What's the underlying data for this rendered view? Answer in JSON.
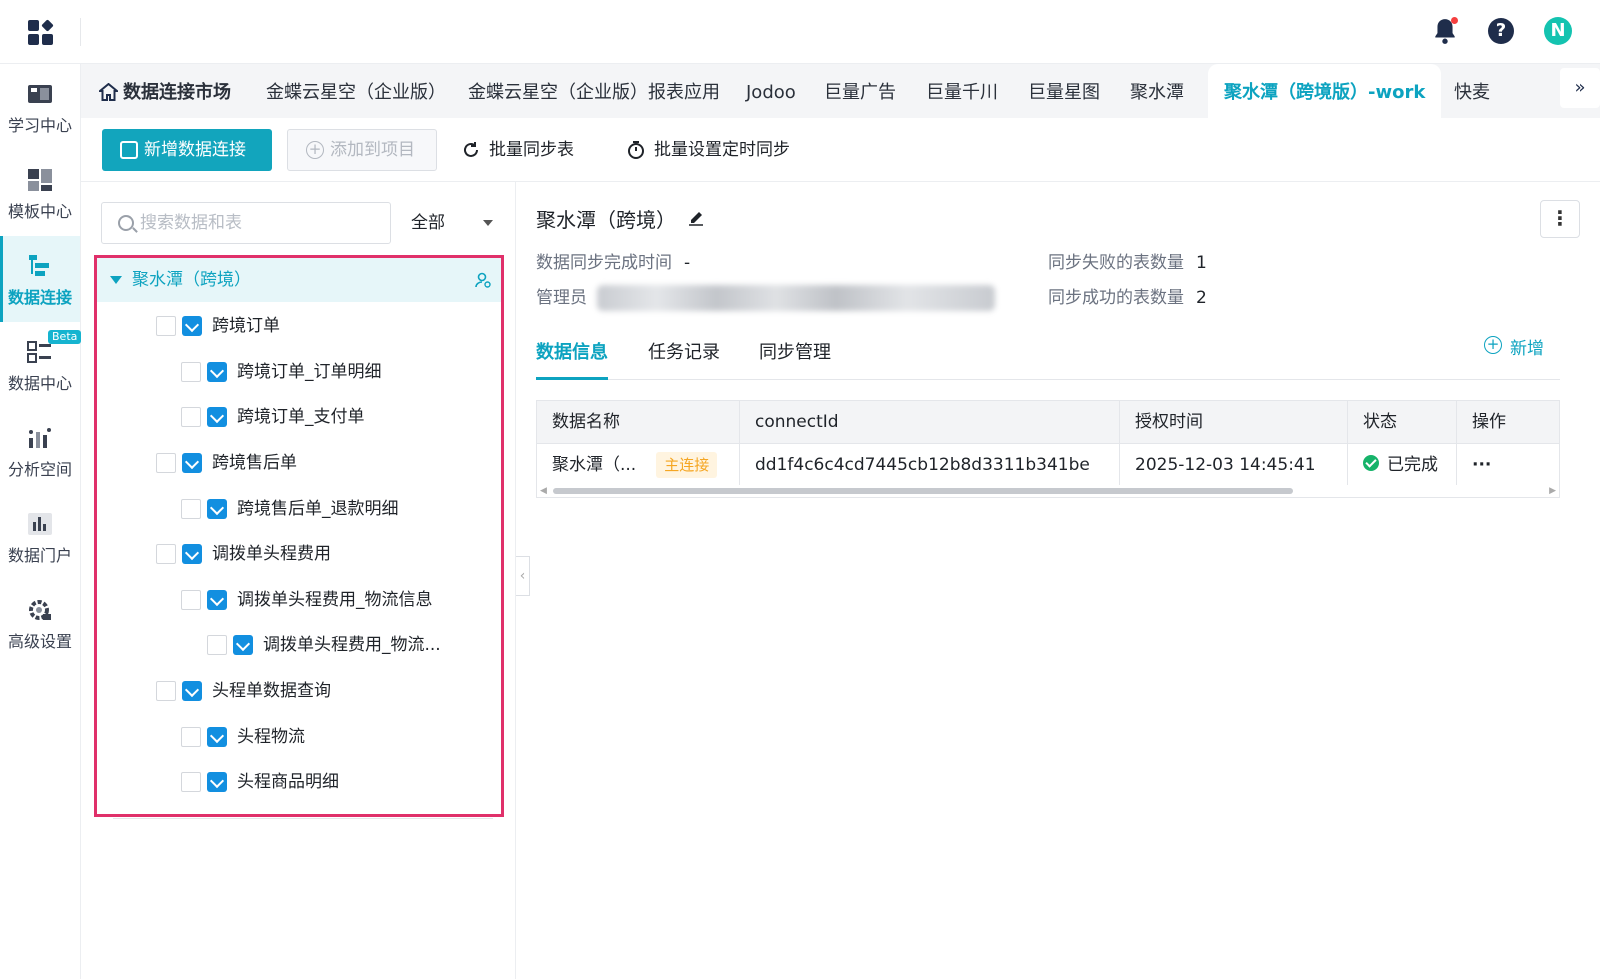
{
  "nav": {
    "items": [
      {
        "label": "学习中心",
        "icon": "learning-center-icon"
      },
      {
        "label": "模板中心",
        "icon": "template-center-icon"
      },
      {
        "label": "数据连接",
        "icon": "data-connection-icon",
        "active": true
      },
      {
        "label": "数据中心",
        "icon": "data-center-icon",
        "badge": "Beta"
      },
      {
        "label": "分析空间",
        "icon": "analysis-space-icon"
      },
      {
        "label": "数据门户",
        "icon": "data-portal-icon"
      },
      {
        "label": "高级设置",
        "icon": "advanced-settings-icon"
      }
    ]
  },
  "topbar": {
    "avatar_letter": "N",
    "help_glyph": "?"
  },
  "tabs": {
    "home": "数据连接市场",
    "items": [
      "金蝶云星空（企业版）",
      "金蝶云星空（企业版）报表应用",
      "Jodoo",
      "巨量广告",
      "巨量千川",
      "巨量星图",
      "聚水潭",
      "聚水潭（跨境版）-work",
      "快麦"
    ],
    "active_index": 7,
    "more_glyph": "»"
  },
  "toolbar": {
    "new_connection": "新增数据连接",
    "add_to_project": "添加到项目",
    "batch_sync": "批量同步表",
    "batch_schedule": "批量设置定时同步"
  },
  "tree": {
    "search_placeholder": "搜索数据和表",
    "filter": "全部",
    "root": "聚水潭（跨境）",
    "nodes": [
      {
        "label": "跨境订单",
        "level": 0
      },
      {
        "label": "跨境订单_订单明细",
        "level": 1
      },
      {
        "label": "跨境订单_支付单",
        "level": 1
      },
      {
        "label": "跨境售后单",
        "level": 0
      },
      {
        "label": "跨境售后单_退款明细",
        "level": 1
      },
      {
        "label": "调拨单头程费用",
        "level": 0
      },
      {
        "label": "调拨单头程费用_物流信息",
        "level": 1
      },
      {
        "label": "调拨单头程费用_物流...",
        "level": 2
      },
      {
        "label": "头程单数据查询",
        "level": 0
      },
      {
        "label": "头程物流",
        "level": 1
      },
      {
        "label": "头程商品明细",
        "level": 1
      }
    ]
  },
  "detail": {
    "title": "聚水潭（跨境）",
    "sync_time_label": "数据同步完成时间",
    "sync_time_value": "-",
    "admin_label": "管理员",
    "failed_label": "同步失败的表数量",
    "failed_value": "1",
    "success_label": "同步成功的表数量",
    "success_value": "2",
    "tabs": [
      "数据信息",
      "任务记录",
      "同步管理"
    ],
    "add_label": "新增",
    "table": {
      "columns": [
        "数据名称",
        "connectId",
        "授权时间",
        "状态",
        "操作"
      ],
      "rows": [
        {
          "name": "聚水潭（...",
          "tag": "主连接",
          "connect_id": "dd1f4c6c4cd7445cb12b8d3311b341be",
          "auth_time": "2025-12-03 14:45:41",
          "status": "已完成",
          "ops": "···"
        }
      ]
    }
  },
  "colors": {
    "accent": "#0da3c0",
    "primary_button": "#12a5bd",
    "highlight_border": "#e0306a",
    "tag_text": "#f5a623",
    "success": "#16b36a"
  }
}
